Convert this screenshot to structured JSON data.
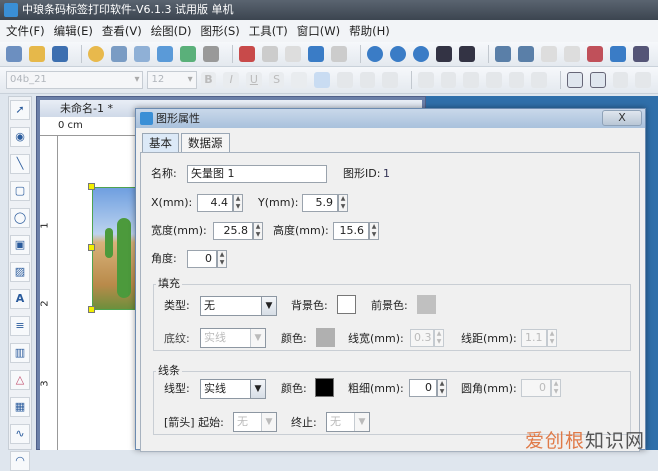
{
  "app": {
    "title": "中琅条码标签打印软件-V6.1.3 试用版 单机"
  },
  "menu": [
    "文件(F)",
    "编辑(E)",
    "查看(V)",
    "绘图(D)",
    "图形(S)",
    "工具(T)",
    "窗口(W)",
    "帮助(H)"
  ],
  "format_toolbar": {
    "font": "04b_21",
    "size": "12"
  },
  "document": {
    "title": "未命名-1 *",
    "ruler_unit": "0 cm",
    "ruler_v_labels": [
      "1",
      "2",
      "3"
    ]
  },
  "dialog": {
    "title": "图形属性",
    "close": "X",
    "tabs": [
      "基本",
      "数据源"
    ],
    "name_label": "名称:",
    "name_value": "矢量图 1",
    "id_label": "图形ID:",
    "id_value": "1",
    "x_label": "X(mm):",
    "x_value": "4.4",
    "y_label": "Y(mm):",
    "y_value": "5.9",
    "width_label": "宽度(mm):",
    "width_value": "25.8",
    "height_label": "高度(mm):",
    "height_value": "15.6",
    "angle_label": "角度:",
    "angle_value": "0",
    "fill": {
      "title": "填充",
      "type_label": "类型:",
      "type_value": "无",
      "bg_label": "背景色:",
      "bg_color": "#ffffff",
      "fg_label": "前景色:",
      "fg_color": "#c0c0c0",
      "pattern_label": "底纹:",
      "pattern_value": "实线",
      "color_label": "颜色:",
      "color": "#b0b0b0",
      "lw_label": "线宽(mm):",
      "lw_value": "0.3",
      "ls_label": "线距(mm):",
      "ls_value": "1.1"
    },
    "line": {
      "title": "线条",
      "type_label": "线型:",
      "type_value": "实线",
      "color_label": "颜色:",
      "color": "#000000",
      "thick_label": "粗细(mm):",
      "thick_value": "0",
      "radius_label": "圆角(mm):",
      "radius_value": "0",
      "arrow_label": "[箭头] 起始:",
      "arrow_start": "无",
      "arrow_end_label": "终止:",
      "arrow_end": "无"
    }
  },
  "watermark": {
    "a": "爱创根",
    "b": "知识网"
  }
}
